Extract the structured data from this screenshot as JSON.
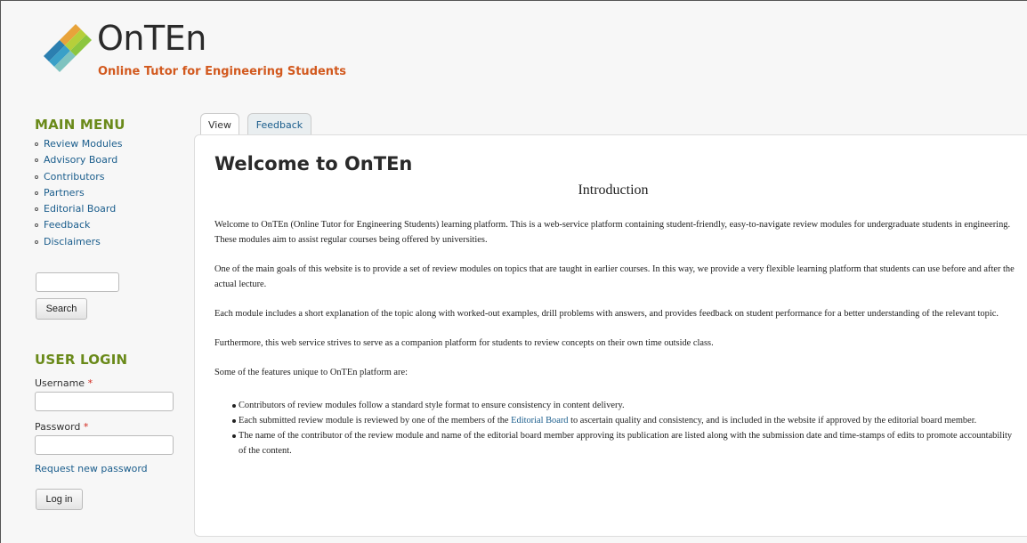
{
  "site": {
    "name": "OnTEn",
    "slogan": "Online Tutor for Engineering Students",
    "logo_icon": "stacked-diamond-logo"
  },
  "main_menu": {
    "title": "MAIN MENU",
    "items": [
      {
        "label": "Review Modules"
      },
      {
        "label": "Advisory Board"
      },
      {
        "label": "Contributors"
      },
      {
        "label": "Partners"
      },
      {
        "label": "Editorial Board"
      },
      {
        "label": "Feedback"
      },
      {
        "label": "Disclaimers"
      }
    ]
  },
  "search": {
    "placeholder": "",
    "button_label": "Search"
  },
  "user_login": {
    "title": "USER LOGIN",
    "username_label": "Username",
    "password_label": "Password",
    "required_mark": "*",
    "request_password_label": "Request new password",
    "login_button_label": "Log in"
  },
  "tabs": [
    {
      "label": "View",
      "active": true
    },
    {
      "label": "Feedback",
      "active": false
    }
  ],
  "content": {
    "title": "Welcome to OnTEn",
    "intro_heading": "Introduction",
    "paragraphs": [
      "Welcome to OnTEn (Online Tutor for Engineering Students) learning platform. This is a web-service platform containing student-friendly, easy-to-navigate review modules for undergraduate students in engineering. These modules aim to assist regular courses being offered by universities.",
      "One of the main goals of this website is to provide a  set of review modules on topics that are taught in earlier courses. In this way, we provide a very flexible learning platform that students can use before and after the actual lecture.",
      "Each module includes a short explanation of the topic along with worked-out examples, drill problems with answers, and provides feedback on student performance for a better understanding of the relevant topic.",
      "Furthermore, this web service strives to serve as a companion platform for students to review concepts on their own time outside class.",
      "Some of the features unique to OnTEn platform are:"
    ],
    "features": {
      "item1": "Contributors of review modules follow a standard style format to ensure consistency in content delivery.",
      "item2_before": "Each submitted review module is reviewed by one of the members of the ",
      "item2_link": "Editorial Board",
      "item2_after": " to ascertain quality and consistency, and is included in the website if approved by the editorial board member.",
      "item3": "The name of the contributor of the review module and name of the editorial board member approving its publication are listed along with the submission date and time-stamps of edits  to promote accountability of the content."
    }
  },
  "colors": {
    "accent_green": "#6a8a1a",
    "slogan_orange": "#d2591e",
    "link_blue": "#1a5d8c"
  }
}
